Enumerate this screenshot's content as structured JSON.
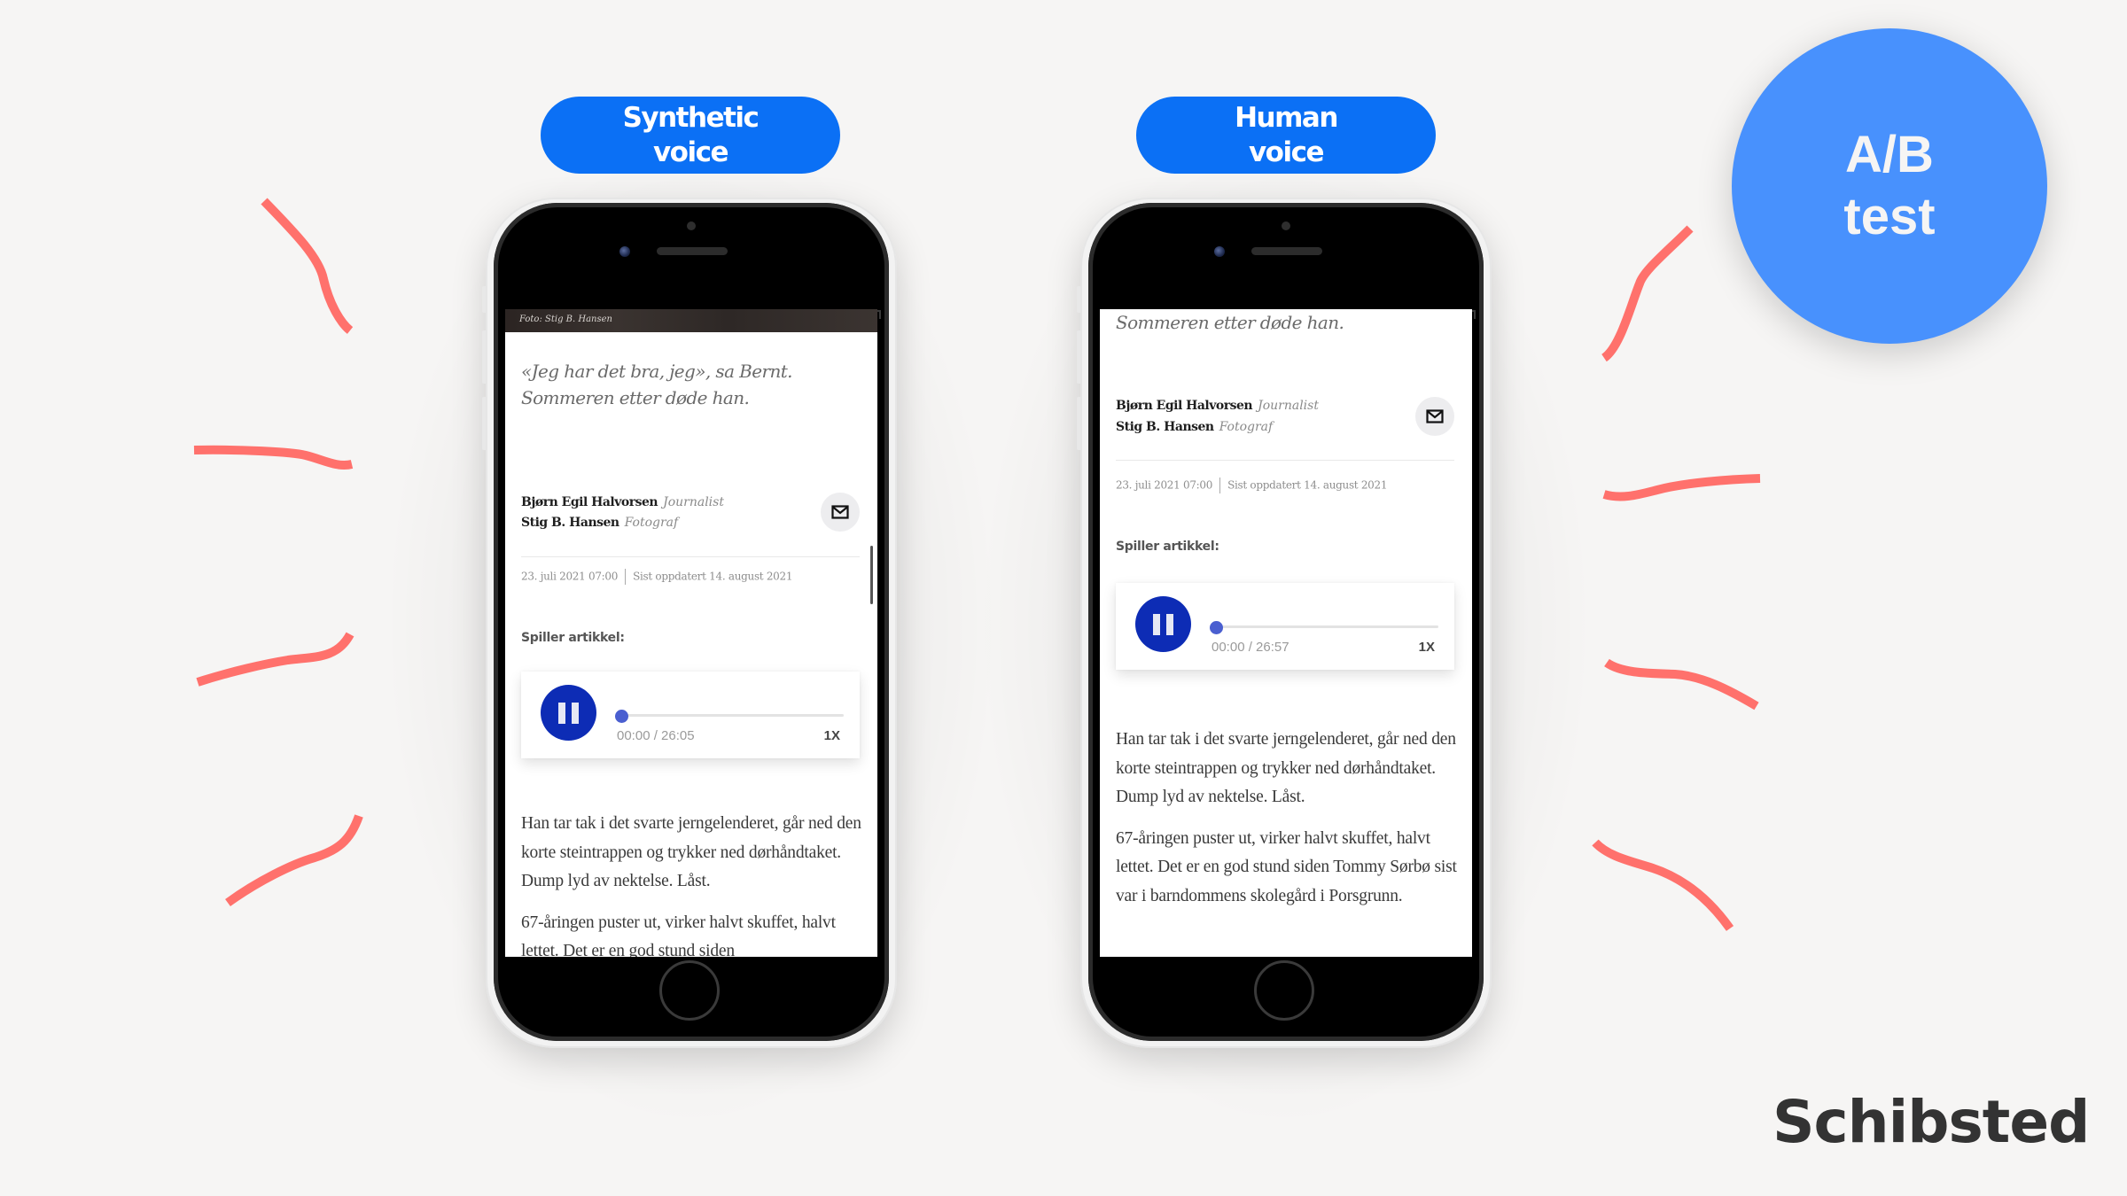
{
  "slide": {
    "background": "#F6F5F4",
    "accent_squiggle_color": "#FF716C",
    "badge": {
      "line1": "A/B",
      "line2": "test",
      "color": "#4891FD"
    },
    "logo": {
      "text": "Schibsted"
    }
  },
  "variants": [
    {
      "label_line1": "Synthetic",
      "label_line2": "voice",
      "pill_color": "#0B70F5",
      "article": {
        "photo_credit": "Foto: Stig B. Hansen",
        "quote_lines": [
          "«Jeg har det bra, jeg», sa Bernt.",
          "Sommeren etter døde han."
        ],
        "authors": [
          {
            "name": "Bjørn Egil Halvorsen",
            "role": "Journalist"
          },
          {
            "name": "Stig B. Hansen",
            "role": "Fotograf"
          }
        ],
        "mail_icon": "mail-icon",
        "published": "23. juli 2021 07:00",
        "updated": "Sist oppdatert 14. august 2021",
        "player_heading": "Spiller artikkel:",
        "player": {
          "state_icon": "pause-icon",
          "elapsed": "00:00",
          "duration": "26:05",
          "time_label": "00:00 / 26:05",
          "speed": "1X",
          "progress": 0
        },
        "paragraphs": [
          "Han tar tak i det svarte jerngelenderet, går ned den korte steintrappen og trykker ned dørhåndtaket. Dump lyd av nektelse. Låst.",
          "67-åringen puster ut, virker halvt skuffet, halvt lettet. Det er en god stund siden"
        ]
      }
    },
    {
      "label_line1": "Human",
      "label_line2": "voice",
      "pill_color": "#0B70F5",
      "article": {
        "quote_lines": [
          "Sommeren etter døde han."
        ],
        "authors": [
          {
            "name": "Bjørn Egil Halvorsen",
            "role": "Journalist"
          },
          {
            "name": "Stig B. Hansen",
            "role": "Fotograf"
          }
        ],
        "mail_icon": "mail-icon",
        "published": "23. juli 2021 07:00",
        "updated": "Sist oppdatert 14. august 2021",
        "player_heading": "Spiller artikkel:",
        "player": {
          "state_icon": "pause-icon",
          "elapsed": "00:00",
          "duration": "26:57",
          "time_label": "00:00 / 26:57",
          "speed": "1X",
          "progress": 0
        },
        "paragraphs": [
          "Han tar tak i det svarte jerngelenderet, går ned den korte steintrappen og trykker ned dørhåndtaket. Dump lyd av nektelse. Låst.",
          "67-åringen puster ut, virker halvt skuffet, halvt lettet. Det er en god stund siden Tommy Sørbø sist var i barndommens skolegård i Porsgrunn."
        ]
      }
    }
  ]
}
